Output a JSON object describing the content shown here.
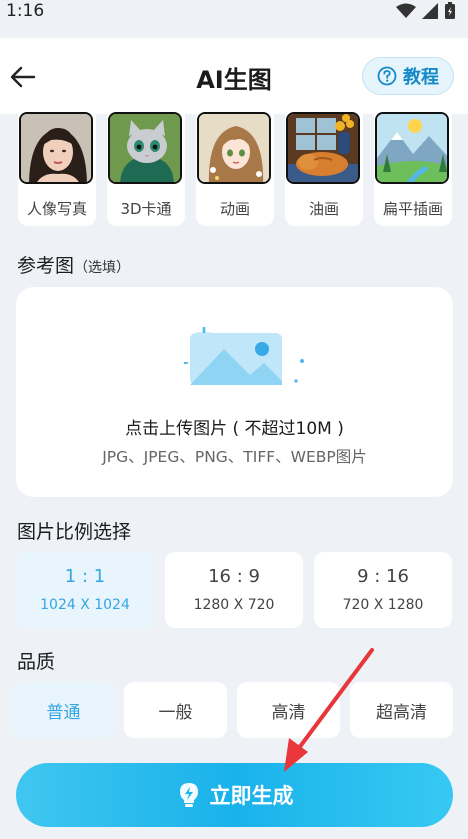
{
  "status": {
    "time": "1:16"
  },
  "header": {
    "title": "AI生图",
    "tutorial_label": "教程"
  },
  "styles": [
    {
      "label": "人像写真",
      "icon": "portrait-thumbnail"
    },
    {
      "label": "3D卡通",
      "icon": "3d-cat-thumbnail"
    },
    {
      "label": "动画",
      "icon": "anime-girl-thumbnail"
    },
    {
      "label": "油画",
      "icon": "oil-painting-cat-thumbnail"
    },
    {
      "label": "扁平插画",
      "icon": "flat-landscape-thumbnail"
    }
  ],
  "reference": {
    "title": "参考图",
    "optional": "（选填）",
    "upload_main": "点击上传图片 ( 不超过10M )",
    "upload_formats": "JPG、JPEG、PNG、TIFF、WEBP图片"
  },
  "ratio": {
    "title": "图片比例选择",
    "options": [
      {
        "ratio": "1 : 1",
        "size": "1024 X 1024",
        "selected": true
      },
      {
        "ratio": "16 : 9",
        "size": "1280 X 720",
        "selected": false
      },
      {
        "ratio": "9 : 16",
        "size": "720 X 1280",
        "selected": false
      }
    ]
  },
  "quality": {
    "title": "品质",
    "options": [
      {
        "label": "普通",
        "selected": true
      },
      {
        "label": "一般",
        "selected": false
      },
      {
        "label": "高清",
        "selected": false
      },
      {
        "label": "超高清",
        "selected": false
      }
    ]
  },
  "generate": {
    "label": "立即生成"
  },
  "colors": {
    "accent": "#35a6e3",
    "button": "#19b2ea",
    "annotation_arrow": "#e8363a"
  }
}
